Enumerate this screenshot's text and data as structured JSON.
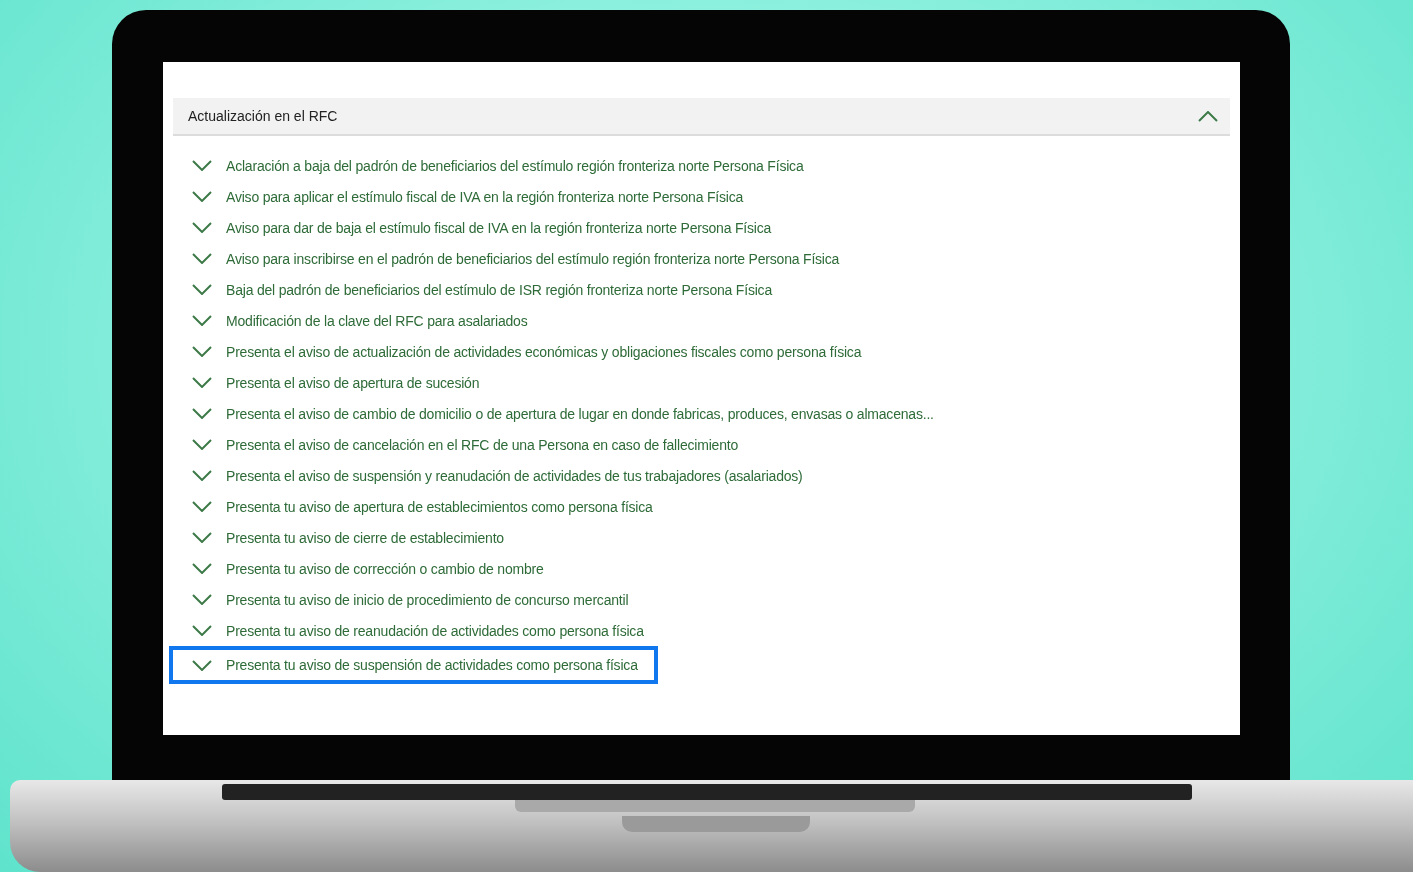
{
  "section": {
    "title": "Actualización en el RFC",
    "expanded": true
  },
  "items": [
    {
      "label": "Aclaración a baja del padrón de beneficiarios del estímulo región fronteriza norte Persona Física",
      "highlighted": false
    },
    {
      "label": "Aviso para aplicar el estímulo fiscal de IVA en la región fronteriza norte Persona Física",
      "highlighted": false
    },
    {
      "label": "Aviso para dar de baja el estímulo fiscal de IVA en la región fronteriza norte Persona Física",
      "highlighted": false
    },
    {
      "label": "Aviso para inscribirse en el padrón de beneficiarios del estímulo región fronteriza norte Persona Física",
      "highlighted": false
    },
    {
      "label": "Baja del padrón de beneficiarios del estímulo de ISR región fronteriza norte Persona Física",
      "highlighted": false
    },
    {
      "label": "Modificación de la clave del RFC para asalariados",
      "highlighted": false
    },
    {
      "label": "Presenta el aviso de actualización de actividades económicas y obligaciones fiscales como persona física",
      "highlighted": false
    },
    {
      "label": "Presenta el aviso de apertura de sucesión",
      "highlighted": false
    },
    {
      "label": "Presenta el aviso de cambio de domicilio o de apertura de lugar en donde fabricas, produces, envasas o almacenas...",
      "highlighted": false
    },
    {
      "label": "Presenta el aviso de cancelación en el RFC de una Persona en caso de fallecimiento",
      "highlighted": false
    },
    {
      "label": "Presenta el aviso de suspensión y reanudación de actividades de tus trabajadores (asalariados)",
      "highlighted": false
    },
    {
      "label": "Presenta tu aviso de apertura de establecimientos como persona física",
      "highlighted": false
    },
    {
      "label": "Presenta tu aviso de cierre de establecimiento",
      "highlighted": false
    },
    {
      "label": "Presenta tu aviso de corrección o cambio de nombre",
      "highlighted": false
    },
    {
      "label": "Presenta tu aviso de inicio de procedimiento de concurso mercantil",
      "highlighted": false
    },
    {
      "label": "Presenta tu aviso de reanudación de actividades como persona física",
      "highlighted": false
    },
    {
      "label": "Presenta tu aviso de suspensión de actividades como persona física",
      "highlighted": true
    }
  ]
}
